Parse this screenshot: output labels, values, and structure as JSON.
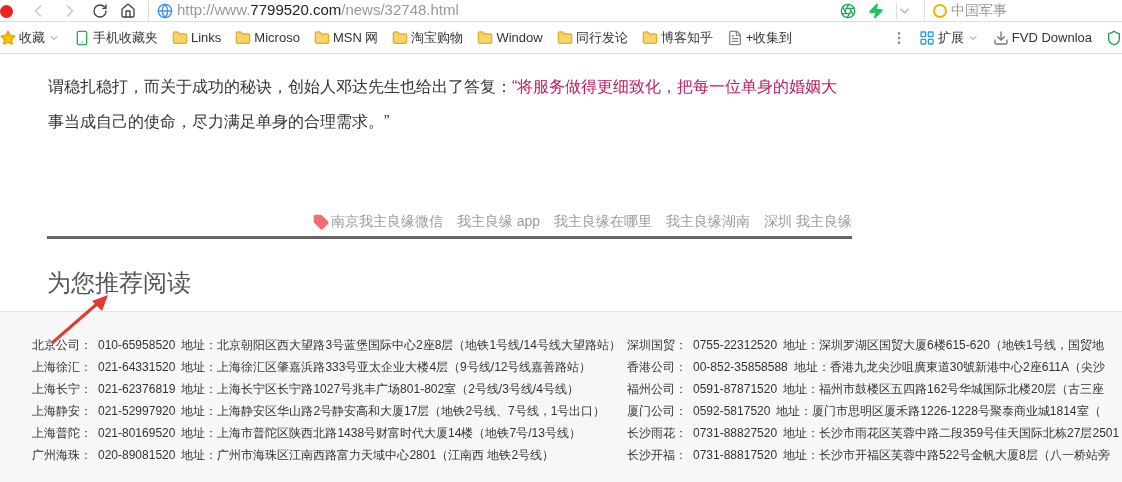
{
  "toolbar": {
    "back": {
      "disabled": true
    },
    "forward": {
      "disabled": true
    },
    "url_host": "http://www.",
    "url_domain": "7799520.com",
    "url_path": "/news/32748.html",
    "search": {
      "placeholder": "中国军事"
    }
  },
  "bookmarks": [
    {
      "label": "收藏",
      "kind": "favorites"
    },
    {
      "label": "手机收藏夹",
      "kind": "phone"
    },
    {
      "label": "Links",
      "kind": "folder"
    },
    {
      "label": "Microso",
      "kind": "folder"
    },
    {
      "label": "MSN 网",
      "kind": "folder"
    },
    {
      "label": "淘宝购物",
      "kind": "folder"
    },
    {
      "label": "Window",
      "kind": "folder"
    },
    {
      "label": "同行发论",
      "kind": "folder"
    },
    {
      "label": "博客知乎",
      "kind": "folder"
    },
    {
      "label": "+收集到",
      "kind": "page"
    }
  ],
  "extensions": [
    {
      "label": "扩展",
      "kind": "apps"
    },
    {
      "label": "FVD Downloa",
      "kind": "download"
    }
  ],
  "article": {
    "lines": [
      "谓稳扎稳打，而关于成功的秘诀，创始人邓达先生也给出了答复：",
      "“将服务做得更细致化，把每一位单身的婚姻大",
      "事当成自己的使命，尽力满足单身的合理需求。”"
    ]
  },
  "tags": [
    "南京我主良缘微信",
    "我主良缘 app",
    "我主良缘在哪里",
    "我主良缘湖南",
    "深圳 我主良缘"
  ],
  "recommend": {
    "title": "为您推荐阅读"
  },
  "offices_left": [
    {
      "name": "北京公司：",
      "phone": "010-65958520",
      "address": "地址：北京朝阳区西大望路3号蓝堡国际中心2座8层（地铁1号线/14号线大望路站）"
    },
    {
      "name": "上海徐汇：",
      "phone": "021-64331520",
      "address": "地址：上海徐汇区肇嘉浜路333号亚太企业大楼4层（9号线/12号线嘉善路站）"
    },
    {
      "name": "上海长宁：",
      "phone": "021-62376819",
      "address": "地址：上海长宁区长宁路1027号兆丰广场801-802室（2号线/3号线/4号线）"
    },
    {
      "name": "上海静安：",
      "phone": "021-52997920",
      "address": "地址：上海静安区华山路2号静安高和大厦17层（地铁2号线、7号线，1号出口）"
    },
    {
      "name": "上海普陀：",
      "phone": "021-80169520",
      "address": "地址：上海市普陀区陕西北路1438号财富时代大厦14楼（地铁7号/13号线）"
    },
    {
      "name": "广州海珠：",
      "phone": "020-89081520",
      "address": "地址：广州市海珠区江南西路富力天域中心2801（江南西 地铁2号线）"
    }
  ],
  "offices_right": [
    {
      "name": "深圳国贸：",
      "phone": "0755-22312520",
      "address": "地址：深圳罗湖区国贸大厦6楼615-620（地铁1号线，国贸地"
    },
    {
      "name": "香港公司：",
      "phone": "00-852-35858588",
      "address": "地址：香港九龙尖沙咀廣東道30號新港中心2座611A（尖沙"
    },
    {
      "name": "福州公司：",
      "phone": "0591-87871520",
      "address": "地址：福州市鼓楼区五四路162号华城国际北楼20层（古三座"
    },
    {
      "name": "厦门公司：",
      "phone": "0592-5817520",
      "address": "地址：厦门市思明区厦禾路1226-1228号聚泰商业城1814室（"
    },
    {
      "name": "长沙雨花：",
      "phone": "0731-88827520",
      "address": "地址：长沙市雨花区芙蓉中路二段359号佳天国际北栋27层2501"
    },
    {
      "name": "长沙开福：",
      "phone": "0731-88817520",
      "address": "地址：长沙市开福区芙蓉中路522号金帆大厦8层（八一桥站旁"
    }
  ]
}
